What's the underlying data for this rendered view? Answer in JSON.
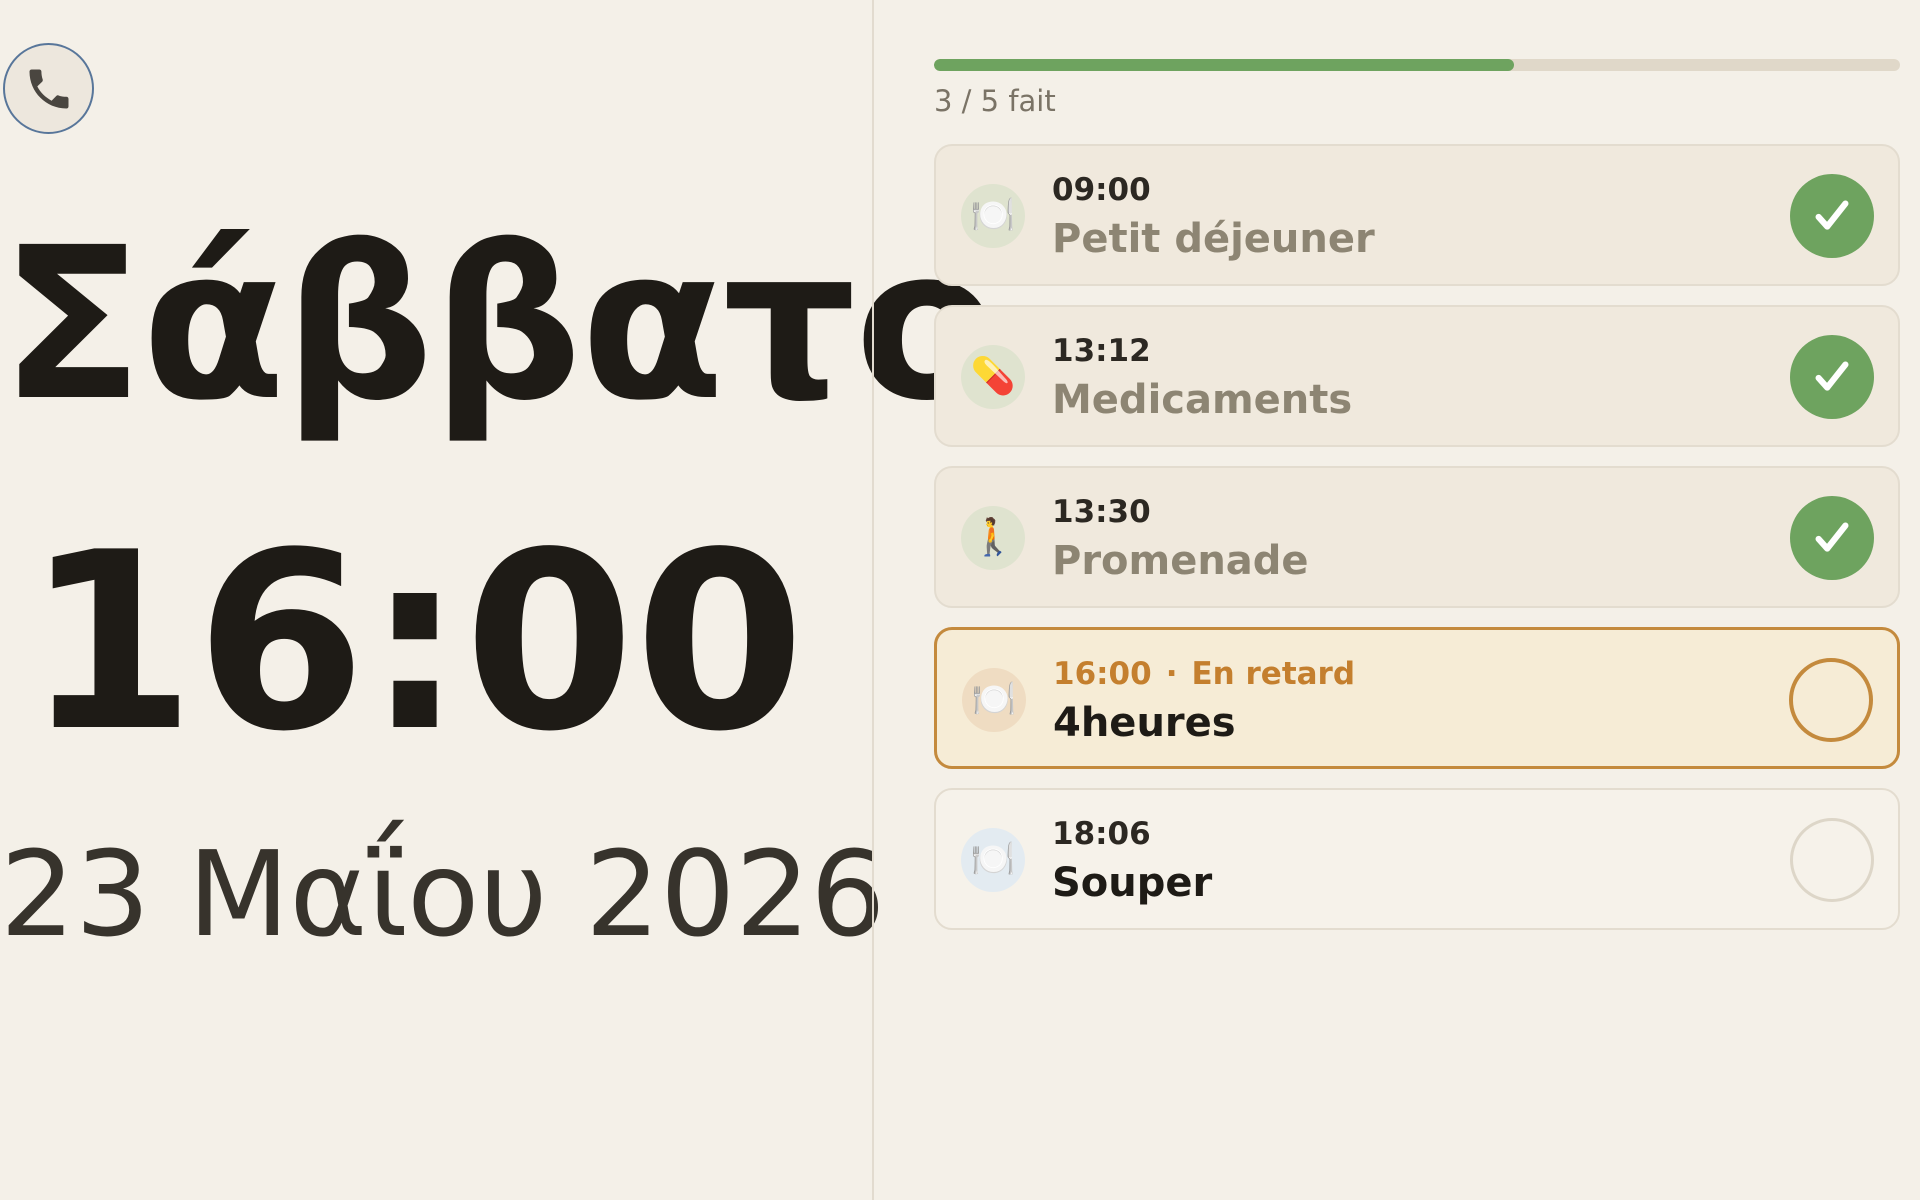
{
  "app": {
    "call_icon": "phone-icon",
    "day_name": "Σάββατο",
    "clock_time": "16:00",
    "date": "23 Μαΐου 2026"
  },
  "progress": {
    "label": "3 / 5 fait",
    "fraction": 0.6,
    "fill_color": "#6ea35f",
    "track_color": "#e0d8c9"
  },
  "tasks": [
    {
      "time": "09:00",
      "title": "Petit déjeuner",
      "icon": "🍽️",
      "icon_name": "plate-cutlery-icon",
      "icon_bg": "#dfe3cf",
      "status": "done",
      "late_label": ""
    },
    {
      "time": "13:12",
      "title": "Medicaments",
      "icon": "💊",
      "icon_name": "pill-icon",
      "icon_bg": "#dfe3cf",
      "status": "done",
      "late_label": ""
    },
    {
      "time": "13:30",
      "title": "Promenade",
      "icon": "🚶",
      "icon_name": "walking-person-icon",
      "icon_bg": "#dfe3cf",
      "status": "done",
      "late_label": ""
    },
    {
      "time": "16:00",
      "title": "4heures",
      "icon": "🍽️",
      "icon_name": "plate-cutlery-icon",
      "icon_bg": "#efdcc2",
      "status": "late",
      "late_label": "En retard"
    },
    {
      "time": "18:06",
      "title": "Souper",
      "icon": "🍽️",
      "icon_name": "plate-cutlery-icon",
      "icon_bg": "#e3ebf1",
      "status": "todo",
      "late_label": ""
    }
  ],
  "colors": {
    "accent_done": "#6ea35f",
    "accent_late": "#c48a3d",
    "background": "#f4f0e8"
  }
}
